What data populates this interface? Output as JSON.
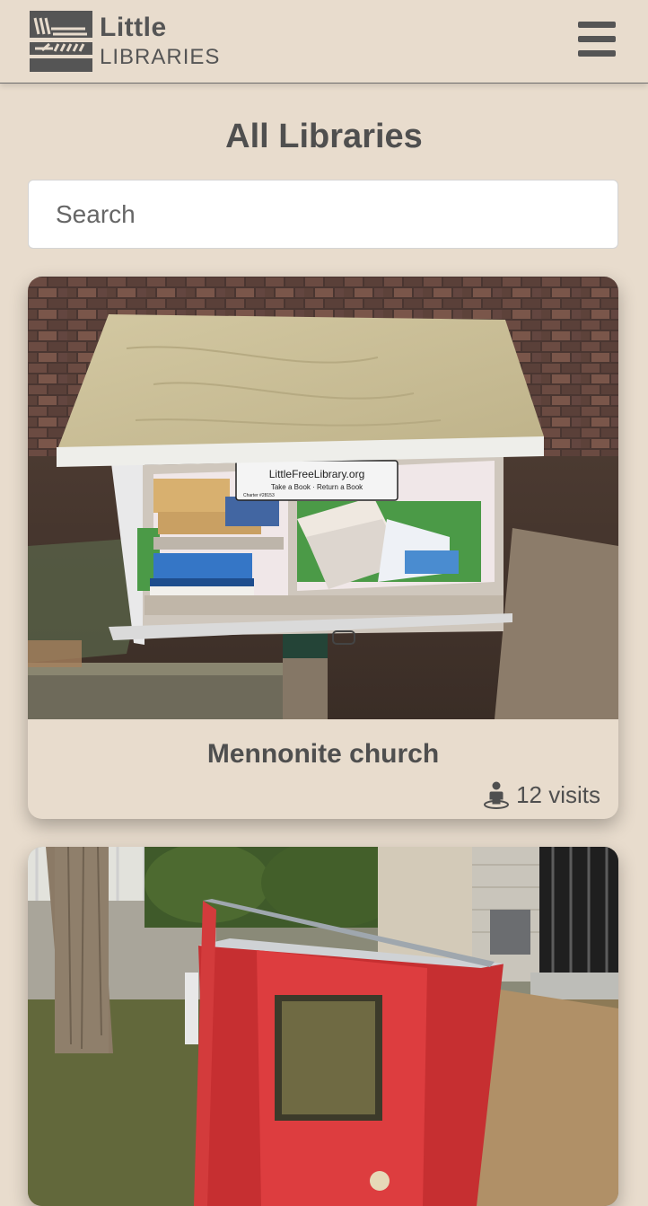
{
  "app": {
    "logo_title": "Little",
    "logo_subtitle": "LIBRARIES",
    "menu_icon": "hamburger-menu-icon"
  },
  "page": {
    "title": "All Libraries"
  },
  "search": {
    "placeholder": "Search",
    "value": ""
  },
  "libraries": [
    {
      "name": "Mennonite church",
      "visits_count": 12,
      "visits_label": "12 visits",
      "visits_icon": "person-pin-icon",
      "photo_sign_line1": "LittleFreeLibrary.org",
      "photo_sign_line2": "Take a Book · Return a Book",
      "photo_sign_line3": "Charter #28153"
    },
    {
      "name": "",
      "photo": "red-little-library-photo"
    }
  ],
  "colors": {
    "background": "#e8dccd",
    "text": "#4f4f4f",
    "logo": "#555555",
    "search_bg": "#ffffff"
  }
}
